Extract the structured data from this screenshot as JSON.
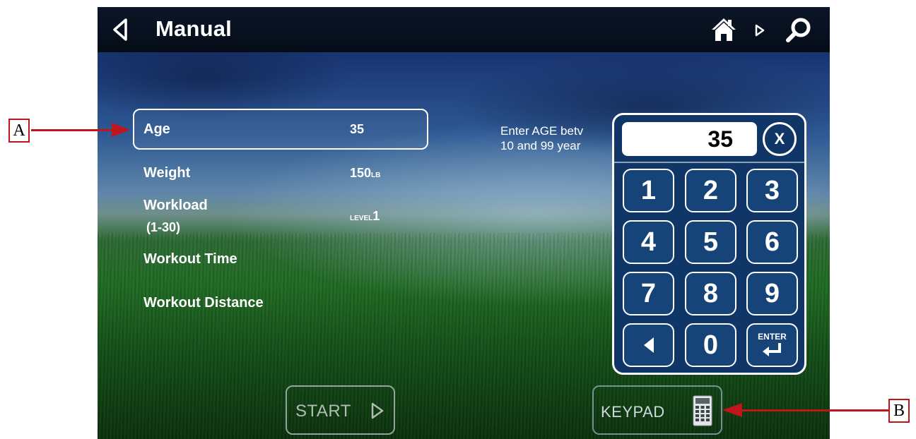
{
  "header": {
    "title": "Manual",
    "icons": [
      "back-icon",
      "home-icon",
      "next-icon",
      "search-icon"
    ]
  },
  "settings": {
    "age": {
      "label": "Age",
      "value": "35"
    },
    "weight": {
      "label": "Weight",
      "value": "150",
      "unit": "LB"
    },
    "workload": {
      "label": "Workload",
      "range": "(1-30)",
      "unit_prefix": "LEVEL",
      "value": "1"
    },
    "workout_time": {
      "label": "Workout Time"
    },
    "workout_distance": {
      "label": "Workout Distance"
    }
  },
  "hint": {
    "line1": "Enter AGE betv",
    "line2": "10 and 99 year"
  },
  "keypad": {
    "display_value": "35",
    "clear_label": "X",
    "keys": [
      "1",
      "2",
      "3",
      "4",
      "5",
      "6",
      "7",
      "8",
      "9"
    ],
    "zero": "0",
    "enter_label": "ENTER"
  },
  "footer": {
    "start_label": "START",
    "keypad_label": "KEYPAD"
  },
  "callouts": {
    "a": "A",
    "b": "B"
  },
  "colors": {
    "callout_red": "#c0151b",
    "keypad_blue": "#0f3666",
    "topbar": "#050c18"
  }
}
